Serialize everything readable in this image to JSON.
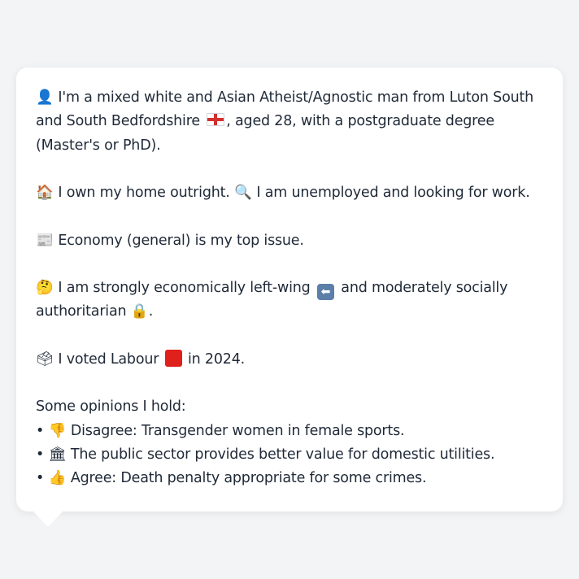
{
  "profile": {
    "intro": "I'm a mixed white and Asian Atheist/Agnostic man from Luton South and South Bedfordshire",
    "intro_rest": ", aged 28, with a postgraduate degree (Master's or PhD).",
    "home": "I own my home outright.",
    "work": "I am unemployed and looking for work.",
    "issue": "Economy (general) is my top issue.",
    "ideology_a": "I am strongly economically left-wing",
    "ideology_b": "and moderately socially authoritarian",
    "ideology_end": ".",
    "vote_a": "I voted Labour",
    "vote_b": "in 2024."
  },
  "opinions": {
    "heading": "Some opinions I hold:",
    "items": [
      {
        "bullet": "•",
        "icon": "👎",
        "icon_name": "thumbs-down-icon",
        "text": "Disagree: Transgender women in female sports."
      },
      {
        "bullet": "•",
        "icon": "🏛",
        "icon_name": "classical-building-icon",
        "text": "The public sector provides better value for domestic utilities."
      },
      {
        "bullet": "•",
        "icon": "👍",
        "icon_name": "thumbs-up-icon",
        "text": "Agree: Death penalty appropriate for some crimes."
      }
    ]
  },
  "icons": {
    "person": "👤",
    "house": "🏠",
    "magnifier": "🔍",
    "newspaper": "📰",
    "thinking": "🤔",
    "arrow_left": "⬅",
    "lock": "🔒",
    "ballot": "🗳"
  },
  "colors": {
    "page_background": "#f3f4f6",
    "bubble_background": "#ffffff",
    "text": "#1f2937",
    "labour_red": "#e0201b",
    "arrow_box": "#5b7fa8"
  }
}
